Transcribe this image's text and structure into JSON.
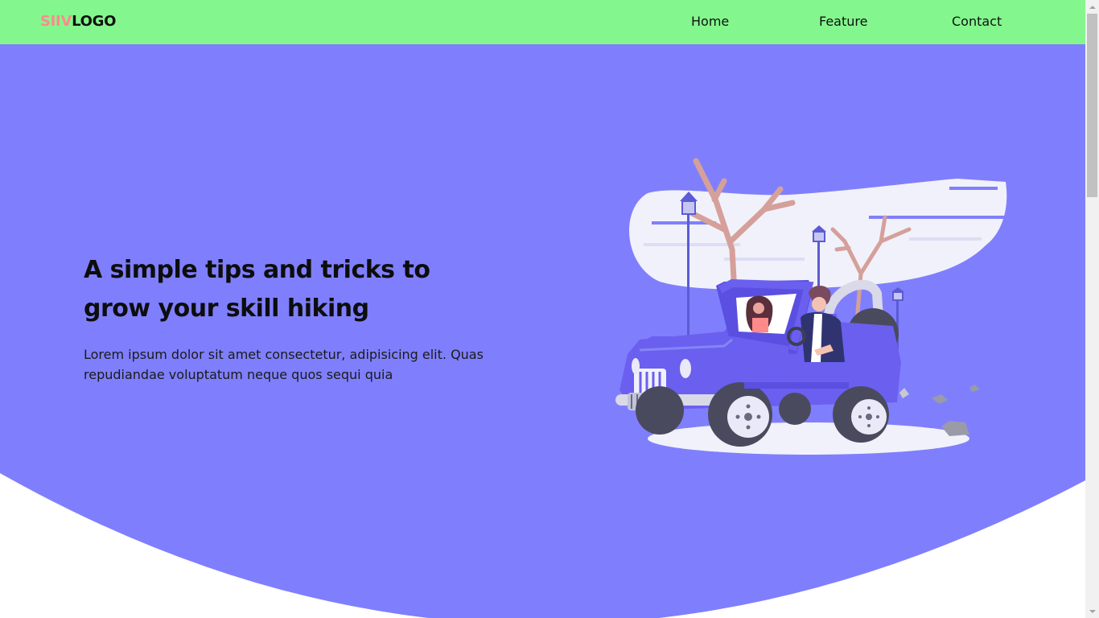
{
  "logo": {
    "accent": "SIIV",
    "main": "LOGO"
  },
  "nav": {
    "home": "Home",
    "feature": "Feature",
    "contact": "Contact"
  },
  "hero": {
    "title": "A simple tips and tricks to grow your skill hiking",
    "text": "Lorem ipsum dolor sit amet consectetur, adipisicing elit. Quas repudiandae voluptatum neque quos sequi quia"
  },
  "colors": {
    "navbar": "#83f78d",
    "hero": "#7f7ffd",
    "logo_accent": "#ff8a8a",
    "jeep": "#6b5ff0"
  },
  "icons": {
    "illustration": "jeep-hiking-illustration"
  }
}
